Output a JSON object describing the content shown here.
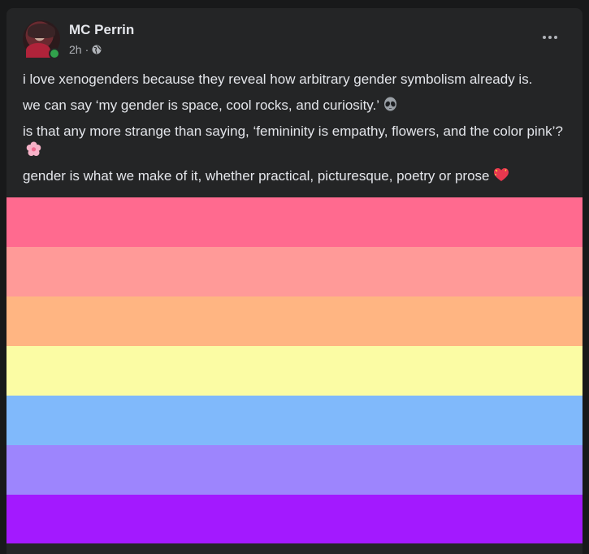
{
  "post": {
    "author": "MC Perrin",
    "time": "2h",
    "separator": "·",
    "privacy_icon": "globe-icon",
    "more_icon": "more-dots-icon",
    "paragraphs": [
      "i love xenogenders because they reveal how arbitrary gender symbolism already is.",
      "we can say ‘my gender is space, cool rocks, and curiosity.’",
      "is that any more strange than saying, ‘femininity is empathy, flowers, and the color pink’?",
      "gender is what we make of it, whether practical, picturesque, poetry or prose"
    ],
    "emojis": [
      "alien-emoji",
      "flower-emoji",
      "heart-emoji"
    ]
  },
  "flag": {
    "name": "",
    "stripes": [
      "#ff6a8f",
      "#ff9a98",
      "#ffb582",
      "#fbfca4",
      "#80b9fb",
      "#9d85fd",
      "#a319ff"
    ]
  },
  "colors": {
    "background": "#18191a",
    "card": "#242526",
    "text_primary": "#e4e6eb",
    "text_secondary": "#b0b3b8",
    "online": "#31a24c"
  }
}
